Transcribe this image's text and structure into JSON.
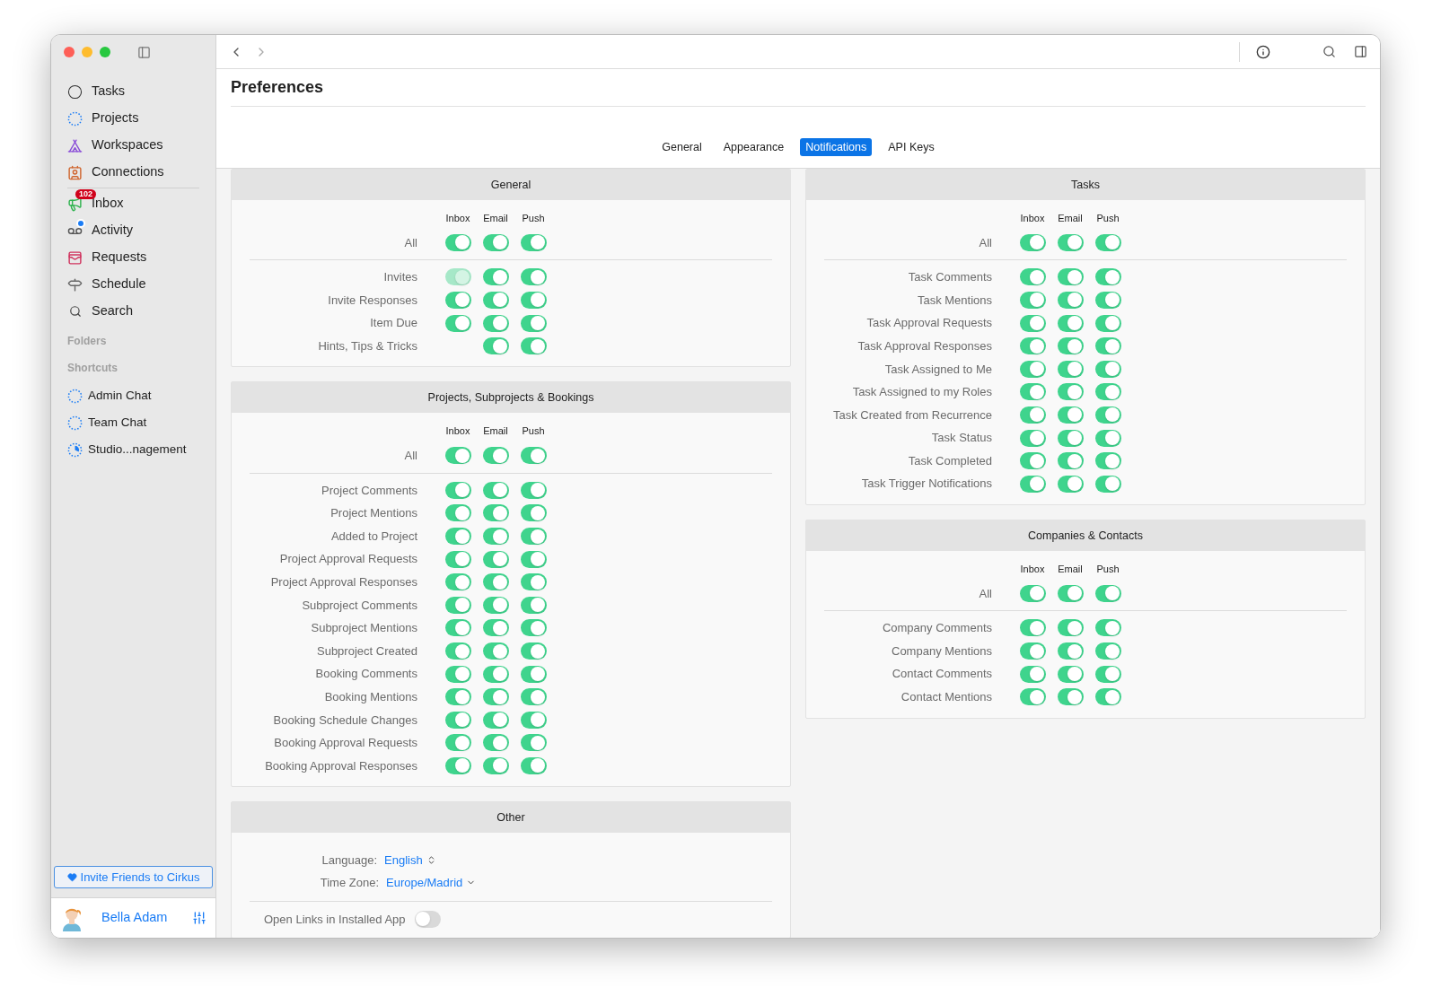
{
  "sidebar": {
    "items": [
      {
        "label": "Tasks",
        "dot": false
      },
      {
        "label": "Projects",
        "dot": false
      },
      {
        "label": "Workspaces",
        "dot": false
      },
      {
        "label": "Connections",
        "dot": false
      },
      {
        "label": "Inbox",
        "badge": "102",
        "dot": false
      },
      {
        "label": "Activity",
        "dot": true
      },
      {
        "label": "Requests",
        "dot": false
      },
      {
        "label": "Schedule",
        "dot": false
      },
      {
        "label": "Search",
        "dot": false
      }
    ],
    "folders_label": "Folders",
    "shortcuts_label": "Shortcuts",
    "shortcuts": [
      {
        "label": "Admin Chat"
      },
      {
        "label": "Team Chat"
      },
      {
        "label": "Studio...nagement"
      }
    ],
    "invite_button": "Invite Friends to Cirkus",
    "user": {
      "name": "Bella Adam"
    }
  },
  "title": "Preferences",
  "tabs": [
    {
      "label": "General",
      "selected": false
    },
    {
      "label": "Appearance",
      "selected": false
    },
    {
      "label": "Notifications",
      "selected": true
    },
    {
      "label": "API Keys",
      "selected": false
    }
  ],
  "columns": [
    {
      "sections": [
        {
          "title": "General",
          "headers": [
            "Inbox",
            "Email",
            "Push"
          ],
          "all": {
            "label": "All",
            "inbox": {
              "on": true,
              "disabled": false
            },
            "email": {
              "on": true,
              "disabled": false
            },
            "push": {
              "on": true,
              "disabled": false
            }
          },
          "rows": [
            {
              "label": "Invites",
              "inbox": {
                "on": true,
                "disabled": true
              },
              "email": {
                "on": true,
                "disabled": false
              },
              "push": {
                "on": true,
                "disabled": false
              }
            },
            {
              "label": "Invite Responses",
              "inbox": {
                "on": true,
                "disabled": false
              },
              "email": {
                "on": true,
                "disabled": false
              },
              "push": {
                "on": true,
                "disabled": false
              }
            },
            {
              "label": "Item Due",
              "inbox": {
                "on": true,
                "disabled": false
              },
              "email": {
                "on": true,
                "disabled": false
              },
              "push": {
                "on": true,
                "disabled": false
              }
            },
            {
              "label": "Hints, Tips & Tricks",
              "email": {
                "on": true,
                "disabled": false
              },
              "push": {
                "on": true,
                "disabled": false
              }
            }
          ]
        },
        {
          "title": "Projects, Subprojects & Bookings",
          "headers": [
            "Inbox",
            "Email",
            "Push"
          ],
          "all": {
            "label": "All",
            "inbox": {
              "on": true,
              "disabled": false
            },
            "email": {
              "on": true,
              "disabled": false
            },
            "push": {
              "on": true,
              "disabled": false
            }
          },
          "rows": [
            {
              "label": "Project Comments",
              "inbox": {
                "on": true,
                "disabled": false
              },
              "email": {
                "on": true,
                "disabled": false
              },
              "push": {
                "on": true,
                "disabled": false
              }
            },
            {
              "label": "Project Mentions",
              "inbox": {
                "on": true,
                "disabled": false
              },
              "email": {
                "on": true,
                "disabled": false
              },
              "push": {
                "on": true,
                "disabled": false
              }
            },
            {
              "label": "Added to Project",
              "inbox": {
                "on": true,
                "disabled": false
              },
              "email": {
                "on": true,
                "disabled": false
              },
              "push": {
                "on": true,
                "disabled": false
              }
            },
            {
              "label": "Project Approval Requests",
              "inbox": {
                "on": true,
                "disabled": false
              },
              "email": {
                "on": true,
                "disabled": false
              },
              "push": {
                "on": true,
                "disabled": false
              }
            },
            {
              "label": "Project Approval Responses",
              "inbox": {
                "on": true,
                "disabled": false
              },
              "email": {
                "on": true,
                "disabled": false
              },
              "push": {
                "on": true,
                "disabled": false
              }
            },
            {
              "label": "Subproject Comments",
              "inbox": {
                "on": true,
                "disabled": false
              },
              "email": {
                "on": true,
                "disabled": false
              },
              "push": {
                "on": true,
                "disabled": false
              }
            },
            {
              "label": "Subproject Mentions",
              "inbox": {
                "on": true,
                "disabled": false
              },
              "email": {
                "on": true,
                "disabled": false
              },
              "push": {
                "on": true,
                "disabled": false
              }
            },
            {
              "label": "Subproject Created",
              "inbox": {
                "on": true,
                "disabled": false
              },
              "email": {
                "on": true,
                "disabled": false
              },
              "push": {
                "on": true,
                "disabled": false
              }
            },
            {
              "label": "Booking Comments",
              "inbox": {
                "on": true,
                "disabled": false
              },
              "email": {
                "on": true,
                "disabled": false
              },
              "push": {
                "on": true,
                "disabled": false
              }
            },
            {
              "label": "Booking Mentions",
              "inbox": {
                "on": true,
                "disabled": false
              },
              "email": {
                "on": true,
                "disabled": false
              },
              "push": {
                "on": true,
                "disabled": false
              }
            },
            {
              "label": "Booking Schedule Changes",
              "inbox": {
                "on": true,
                "disabled": false
              },
              "email": {
                "on": true,
                "disabled": false
              },
              "push": {
                "on": true,
                "disabled": false
              }
            },
            {
              "label": "Booking Approval Requests",
              "inbox": {
                "on": true,
                "disabled": false
              },
              "email": {
                "on": true,
                "disabled": false
              },
              "push": {
                "on": true,
                "disabled": false
              }
            },
            {
              "label": "Booking Approval Responses",
              "inbox": {
                "on": true,
                "disabled": false
              },
              "email": {
                "on": true,
                "disabled": false
              },
              "push": {
                "on": true,
                "disabled": false
              }
            }
          ]
        }
      ],
      "other": {
        "title": "Other",
        "language_label": "Language:",
        "language": "English",
        "timezone_label": "Time Zone:",
        "timezone": "Europe/Madrid",
        "open_links": {
          "label": "Open Links in Installed App",
          "on": false
        }
      }
    },
    {
      "sections": [
        {
          "title": "Tasks",
          "headers": [
            "Inbox",
            "Email",
            "Push"
          ],
          "all": {
            "label": "All",
            "inbox": {
              "on": true,
              "disabled": false
            },
            "email": {
              "on": true,
              "disabled": false
            },
            "push": {
              "on": true,
              "disabled": false
            }
          },
          "rows": [
            {
              "label": "Task Comments",
              "inbox": {
                "on": true,
                "disabled": false
              },
              "email": {
                "on": true,
                "disabled": false
              },
              "push": {
                "on": true,
                "disabled": false
              }
            },
            {
              "label": "Task Mentions",
              "inbox": {
                "on": true,
                "disabled": false
              },
              "email": {
                "on": true,
                "disabled": false
              },
              "push": {
                "on": true,
                "disabled": false
              }
            },
            {
              "label": "Task Approval Requests",
              "inbox": {
                "on": true,
                "disabled": false
              },
              "email": {
                "on": true,
                "disabled": false
              },
              "push": {
                "on": true,
                "disabled": false
              }
            },
            {
              "label": "Task Approval Responses",
              "inbox": {
                "on": true,
                "disabled": false
              },
              "email": {
                "on": true,
                "disabled": false
              },
              "push": {
                "on": true,
                "disabled": false
              }
            },
            {
              "label": "Task Assigned to Me",
              "inbox": {
                "on": true,
                "disabled": false
              },
              "email": {
                "on": true,
                "disabled": false
              },
              "push": {
                "on": true,
                "disabled": false
              }
            },
            {
              "label": "Task Assigned to my Roles",
              "inbox": {
                "on": true,
                "disabled": false
              },
              "email": {
                "on": true,
                "disabled": false
              },
              "push": {
                "on": true,
                "disabled": false
              }
            },
            {
              "label": "Task Created from Recurrence",
              "inbox": {
                "on": true,
                "disabled": false
              },
              "email": {
                "on": true,
                "disabled": false
              },
              "push": {
                "on": true,
                "disabled": false
              }
            },
            {
              "label": "Task Status",
              "inbox": {
                "on": true,
                "disabled": false
              },
              "email": {
                "on": true,
                "disabled": false
              },
              "push": {
                "on": true,
                "disabled": false
              }
            },
            {
              "label": "Task Completed",
              "inbox": {
                "on": true,
                "disabled": false
              },
              "email": {
                "on": true,
                "disabled": false
              },
              "push": {
                "on": true,
                "disabled": false
              }
            },
            {
              "label": "Task Trigger Notifications",
              "inbox": {
                "on": true,
                "disabled": false
              },
              "email": {
                "on": true,
                "disabled": false
              },
              "push": {
                "on": true,
                "disabled": false
              }
            }
          ]
        },
        {
          "title": "Companies & Contacts",
          "headers": [
            "Inbox",
            "Email",
            "Push"
          ],
          "all": {
            "label": "All",
            "inbox": {
              "on": true,
              "disabled": false
            },
            "email": {
              "on": true,
              "disabled": false
            },
            "push": {
              "on": true,
              "disabled": false
            }
          },
          "rows": [
            {
              "label": "Company Comments",
              "inbox": {
                "on": true,
                "disabled": false
              },
              "email": {
                "on": true,
                "disabled": false
              },
              "push": {
                "on": true,
                "disabled": false
              }
            },
            {
              "label": "Company Mentions",
              "inbox": {
                "on": true,
                "disabled": false
              },
              "email": {
                "on": true,
                "disabled": false
              },
              "push": {
                "on": true,
                "disabled": false
              }
            },
            {
              "label": "Contact Comments",
              "inbox": {
                "on": true,
                "disabled": false
              },
              "email": {
                "on": true,
                "disabled": false
              },
              "push": {
                "on": true,
                "disabled": false
              }
            },
            {
              "label": "Contact Mentions",
              "inbox": {
                "on": true,
                "disabled": false
              },
              "email": {
                "on": true,
                "disabled": false
              },
              "push": {
                "on": true,
                "disabled": false
              }
            }
          ]
        }
      ]
    }
  ]
}
